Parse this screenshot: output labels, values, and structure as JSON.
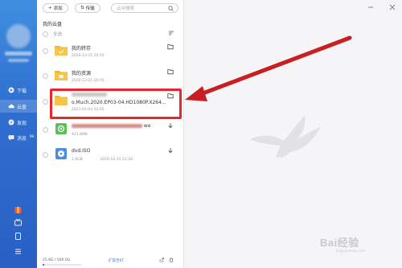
{
  "sidebar": {
    "nav": [
      {
        "label": "下载",
        "icon": "play-circle-icon"
      },
      {
        "label": "云盘",
        "icon": "cloud-icon",
        "active": true
      },
      {
        "label": "发现",
        "icon": "compass-icon"
      },
      {
        "label": "消息",
        "icon": "message-icon",
        "badge": "99"
      }
    ],
    "bottom_icons": [
      "gift-icon",
      "tv-icon",
      "tablet-icon",
      "menu-icon"
    ]
  },
  "toolbar": {
    "add_label": "添加",
    "transfer_label": "传输",
    "search_placeholder": "云中搜索"
  },
  "breadcrumb": "我的云盘",
  "select_all_label": "全选",
  "files": [
    {
      "name": "我的转存",
      "date": "2020-12-25 20:05",
      "size": "",
      "type": "folder",
      "action": "folder-icon"
    },
    {
      "name": "我的资源",
      "date": "2020-12-25 20:05",
      "size": "",
      "type": "folder",
      "action": "folder-icon"
    },
    {
      "name": "o.Much.2020.EP03-04.HD1080P.X264...",
      "date": "2021-01-03 02:05",
      "size": "",
      "type": "folder",
      "action": "folder-icon"
    },
    {
      "name": "we",
      "date": "",
      "size": "421.8MB",
      "type": "video",
      "action": "download-icon"
    },
    {
      "name": "dvd.ISO",
      "date": "2020-12-25 21:28",
      "size": "1.6GB",
      "type": "disc",
      "action": "download-icon"
    }
  ],
  "footer": {
    "quota": "25.8G / 500.0G",
    "expand_label": "扩容至6T",
    "quota_fraction": 0.05
  },
  "watermark": {
    "text": "Bai经验",
    "sub": "jingyan.baidu.com"
  },
  "colors": {
    "sidebar": "#2f6fd0",
    "accent": "#2f7de1",
    "highlight": "#e8262b",
    "folder": "#f5b731"
  }
}
